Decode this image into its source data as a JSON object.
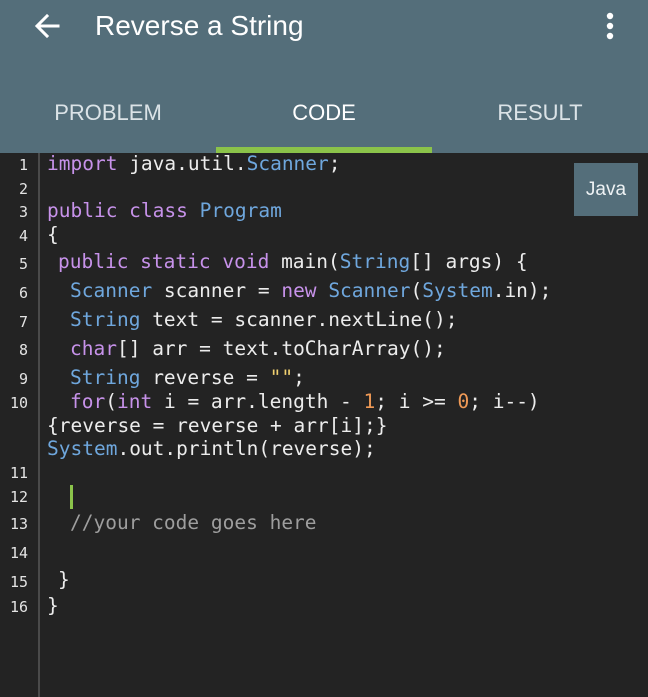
{
  "appbar": {
    "title": "Reverse a String",
    "back_icon": "arrow-left-icon",
    "more_icon": "more-vert-icon"
  },
  "tabs": [
    {
      "label": "PROBLEM",
      "active": false
    },
    {
      "label": "CODE",
      "active": true
    },
    {
      "label": "RESULT",
      "active": false
    }
  ],
  "colors": {
    "appbar": "#546e7a",
    "editor_bg": "#232323",
    "accent": "#8bc34a"
  },
  "editor": {
    "language": "Java",
    "line_numbers": [
      "1",
      "2",
      "3",
      "4",
      "5",
      "6",
      "7",
      "8",
      "9",
      "10",
      "11",
      "12",
      "13",
      "14",
      "15",
      "16"
    ],
    "lines": {
      "l1": {
        "kw": "import",
        "pkg": " java.util.",
        "cls": "Scanner",
        "end": ";"
      },
      "l3": {
        "kw": "public class",
        "sp": " ",
        "cls": "Program"
      },
      "l4": {
        "txt": "{"
      },
      "l5": {
        "kw": "public static void",
        "name": " main(",
        "type": "String",
        "rest": "[] args) {"
      },
      "l6": {
        "type1": "Scanner",
        "mid": " scanner = ",
        "kw": "new",
        "sp": " ",
        "type2": "Scanner",
        "p": "(",
        "type3": "System",
        "rest": ".in);"
      },
      "l7": {
        "type": "String",
        "rest": " text = scanner.nextLine();"
      },
      "l8": {
        "kw": "char",
        "rest": "[] arr = text.toCharArray();"
      },
      "l9": {
        "type": "String",
        "mid": " reverse = ",
        "str": "\"\"",
        "end": ";"
      },
      "l10": {
        "kw1": "for",
        "p1": "(",
        "kw2": "int",
        "mid": " i = arr.length - ",
        "n1": "1",
        "mid2": "; i >= ",
        "n2": "0",
        "end": "; i--)"
      },
      "l10b": {
        "txt": "{reverse = reverse + arr[i];}"
      },
      "l10c": {
        "type": "System",
        "rest": ".out.println(reverse);"
      },
      "l13": {
        "comment": "//your code goes here"
      },
      "l15": {
        "txt": "}"
      },
      "l16": {
        "txt": "}"
      }
    }
  }
}
